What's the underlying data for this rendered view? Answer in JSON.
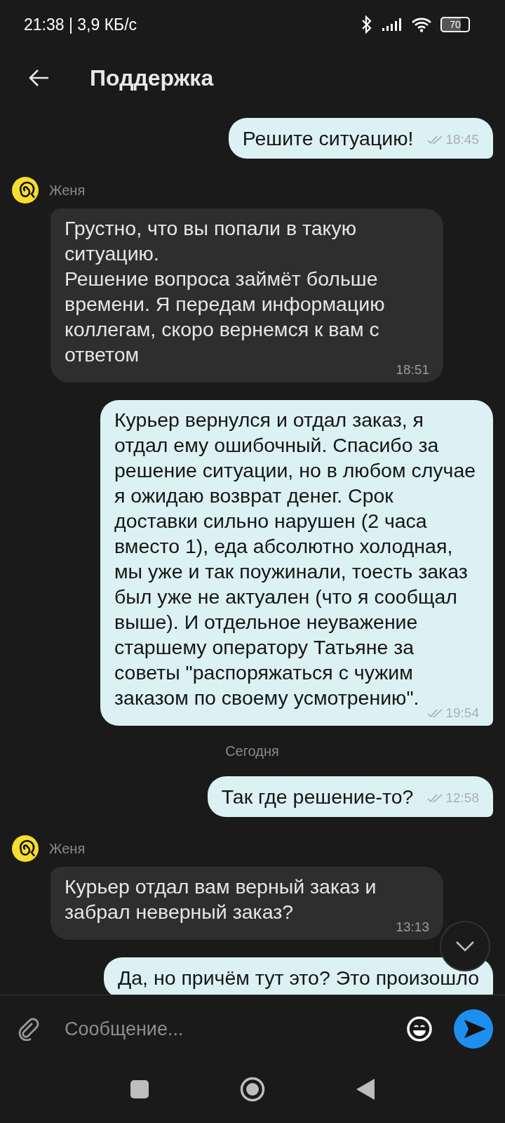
{
  "status_bar": {
    "time": "21:38 | 3,9 КБ/с",
    "battery": "70"
  },
  "header": {
    "title": "Поддержка"
  },
  "messages": [
    {
      "kind": "outgoing",
      "text": "Решите ситуацию!",
      "time": "18:45",
      "read": true
    },
    {
      "kind": "incoming",
      "sender": "Женя",
      "text": "Грустно, что вы попали в такую ситуацию.\nРешение вопроса займёт больше времени. Я передам информацию коллегам, скоро вернемся к вам с ответом",
      "time": "18:51"
    },
    {
      "kind": "outgoing",
      "text": "Курьер вернулся и отдал заказ, я отдал ему ошибочный. Спасибо за решение ситуации, но в любом случае я ожидаю возврат денег. Срок доставки сильно нарушен (2 часа вместо 1), еда абсолютно холодная, мы уже и так поужинали, тоесть заказ был уже не актуален (что я сообщал выше). И отдельное неуважение старшему оператору Татьяне за советы \"распоряжаться с чужим заказом по своему усмотрению\".",
      "time": "19:54",
      "read": true
    },
    {
      "kind": "date",
      "text": "Сегодня"
    },
    {
      "kind": "outgoing",
      "text": "Так где решение-то?",
      "time": "12:58",
      "read": true
    },
    {
      "kind": "incoming",
      "sender": "Женя",
      "text": "Курьер отдал вам верный заказ и забрал неверный заказ?",
      "time": "13:13"
    },
    {
      "kind": "outgoing",
      "text": "Да, но причём тут это? Это произошло"
    }
  ],
  "composer": {
    "placeholder": "Сообщение..."
  }
}
